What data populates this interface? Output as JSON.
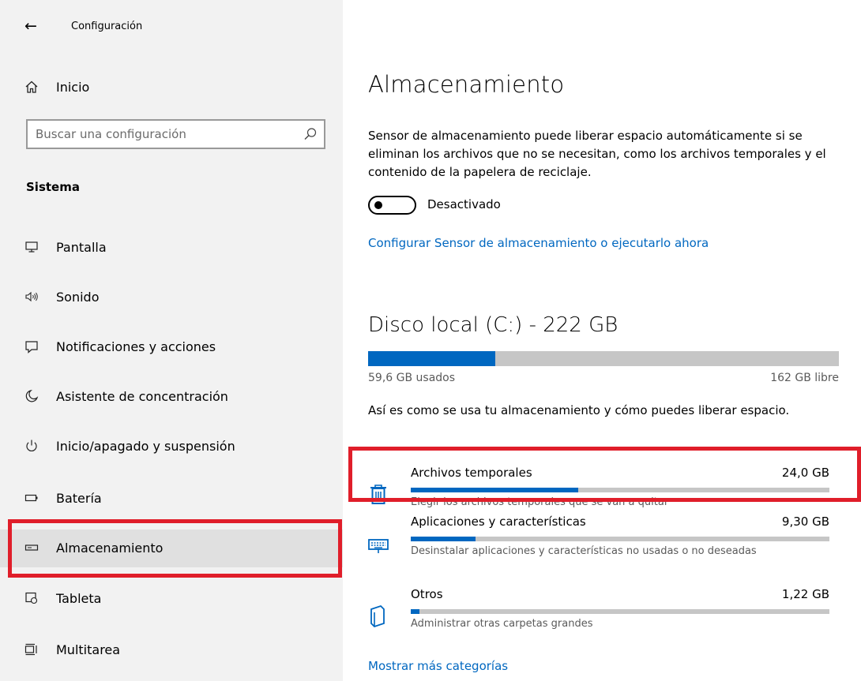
{
  "window": {
    "title": "Configuración",
    "back_glyph": "←"
  },
  "sidebar": {
    "home_label": "Inicio",
    "search_placeholder": "Buscar una configuración",
    "section_title": "Sistema",
    "items": [
      {
        "label": "Pantalla",
        "icon": "monitor-icon",
        "active": false
      },
      {
        "label": "Sonido",
        "icon": "speaker-icon",
        "active": false
      },
      {
        "label": "Notificaciones y acciones",
        "icon": "notification-icon",
        "active": false
      },
      {
        "label": "Asistente de concentración",
        "icon": "moon-icon",
        "active": false
      },
      {
        "label": "Inicio/apagado y suspensión",
        "icon": "power-icon",
        "active": false
      },
      {
        "label": "Batería",
        "icon": "battery-icon",
        "active": false
      },
      {
        "label": "Almacenamiento",
        "icon": "storage-drive-icon",
        "active": true
      },
      {
        "label": "Tableta",
        "icon": "tablet-icon",
        "active": false
      },
      {
        "label": "Multitarea",
        "icon": "multitask-icon",
        "active": false
      }
    ]
  },
  "main": {
    "title": "Almacenamiento",
    "description": "Sensor de almacenamiento puede liberar espacio automáticamente si se eliminan los archivos que no se necesitan, como los archivos temporales y el contenido de la papelera de reciclaje.",
    "toggle": {
      "state": "off",
      "label": "Desactivado"
    },
    "configure_link": "Configurar Sensor de almacenamiento o ejecutarlo ahora",
    "disk": {
      "title": "Disco local (C:) - 222 GB",
      "used_label": "59,6 GB usados",
      "free_label": "162 GB libre",
      "used_fraction": 0.27
    },
    "usage_description": "Así es como se usa tu almacenamiento y cómo puedes liberar espacio.",
    "categories": [
      {
        "name": "Archivos temporales",
        "size": "24,0 GB",
        "description": "Elegir los archivos temporales que se van a quitar",
        "fraction": 0.4,
        "icon": "trash-icon"
      },
      {
        "name": "Aplicaciones y características",
        "size": "9,30 GB",
        "description": "Desinstalar aplicaciones y características no usadas o no deseadas",
        "fraction": 0.155,
        "icon": "keyboard-icon"
      },
      {
        "name": "Otros",
        "size": "1,22 GB",
        "description": "Administrar otras carpetas grandes",
        "fraction": 0.02,
        "icon": "folder-icon"
      }
    ],
    "more_link": "Mostrar más categorías"
  },
  "colors": {
    "accent": "#0067c0",
    "highlight_border": "#e01e2a",
    "sidebar_bg": "#f2f2f2",
    "bar_track": "#c6c6c6"
  }
}
